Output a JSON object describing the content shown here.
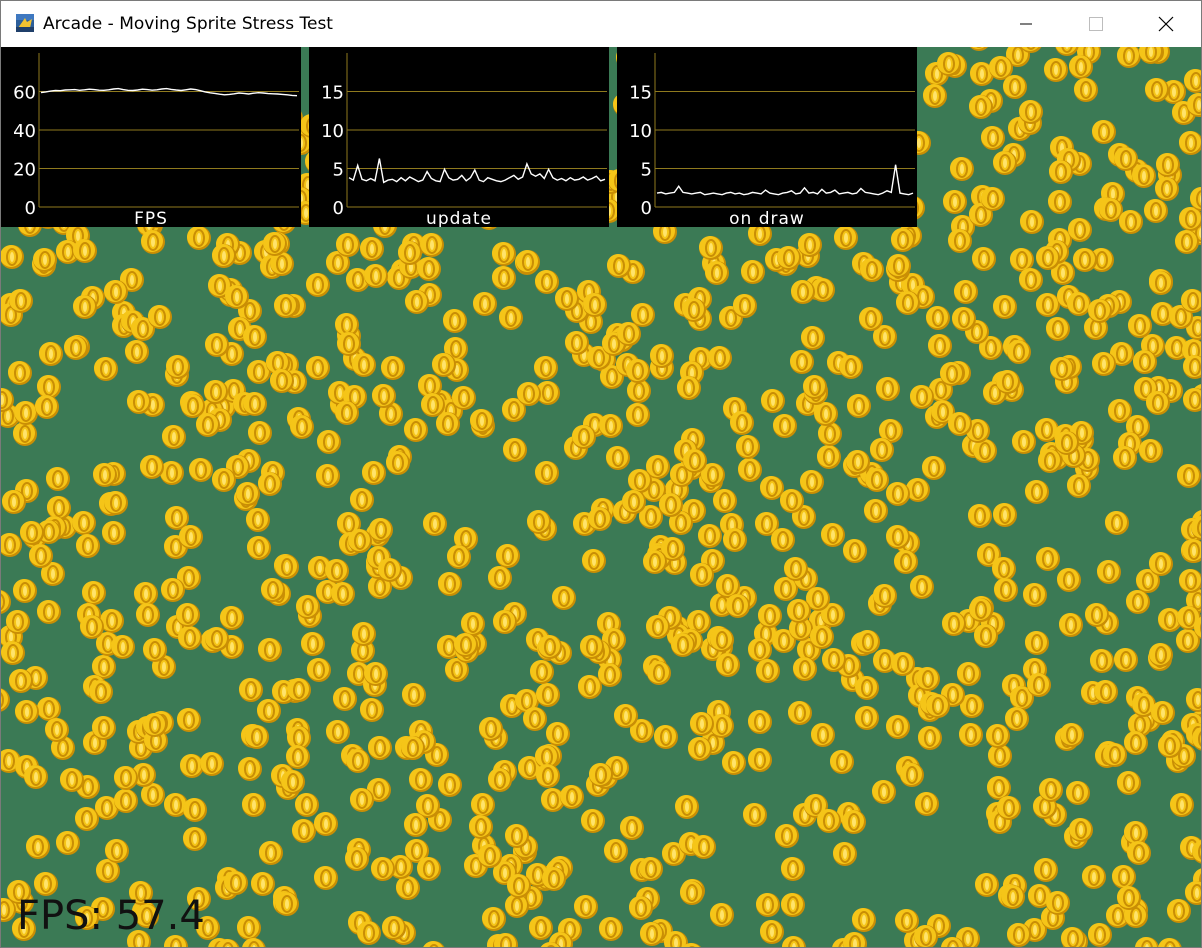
{
  "window": {
    "title": "Arcade - Moving Sprite Stress Test",
    "icon": "python-arcade-icon",
    "controls": [
      "minimize-icon",
      "maximize-icon",
      "close-icon"
    ]
  },
  "colors": {
    "background": "#3b7a55",
    "coin": "#f5c518",
    "coin_dark": "#c98e05",
    "graph_bg": "#000000",
    "graph_grid": "#8f7a1e",
    "graph_line": "#ffffff",
    "graph_text": "#ffffff"
  },
  "graphs": [
    {
      "label": "FPS",
      "y_ticks": [
        "0",
        "20",
        "40",
        "60"
      ],
      "y_max": 80,
      "values": [
        59.5,
        59.8,
        60.2,
        60.5,
        60.4,
        60.8,
        60.9,
        61.0,
        60.6,
        60.9,
        61.2,
        61.0,
        60.7,
        60.6,
        60.9,
        61.3,
        61.5,
        61.0,
        60.6,
        60.5,
        60.8,
        61.2,
        61.0,
        60.7,
        60.9,
        61.3,
        61.5,
        61.1,
        60.8,
        60.5,
        60.9,
        61.3,
        61.0,
        60.4,
        59.8,
        59.3,
        59.0,
        58.6,
        58.3,
        58.5,
        58.8,
        59.2,
        59.0,
        58.7,
        59.1,
        59.4,
        59.2,
        58.9,
        58.8,
        58.7,
        58.5,
        58.3,
        58.0,
        57.8
      ]
    },
    {
      "label": "update",
      "y_ticks": [
        "0",
        "5",
        "10",
        "15"
      ],
      "y_max": 20,
      "values": [
        3.8,
        3.5,
        5.4,
        3.6,
        3.4,
        3.7,
        3.4,
        6.3,
        3.2,
        3.5,
        3.6,
        3.3,
        3.8,
        3.4,
        3.9,
        3.6,
        3.3,
        3.5,
        4.6,
        3.7,
        3.4,
        3.3,
        4.9,
        3.8,
        3.5,
        3.6,
        4.1,
        3.4,
        3.8,
        4.8,
        3.5,
        3.3,
        3.8,
        3.6,
        3.4,
        3.3,
        3.5,
        3.8,
        4.1,
        3.6,
        3.9,
        5.6,
        4.3,
        4.0,
        4.3,
        3.7,
        4.9,
        3.8,
        3.5,
        3.7,
        3.4,
        3.8,
        3.5,
        3.6,
        3.9,
        3.5,
        3.7,
        4.0,
        3.4,
        3.6
      ]
    },
    {
      "label": "on_draw",
      "y_ticks": [
        "0",
        "5",
        "10",
        "15"
      ],
      "y_max": 20,
      "values": [
        1.8,
        1.9,
        1.7,
        1.8,
        1.9,
        2.7,
        1.9,
        1.8,
        1.7,
        1.8,
        1.9,
        1.6,
        1.7,
        1.8,
        1.7,
        1.6,
        1.8,
        1.9,
        1.7,
        1.8,
        1.6,
        1.7,
        1.9,
        1.8,
        1.7,
        2.2,
        1.8,
        1.7,
        1.6,
        1.8,
        1.9,
        2.1,
        1.7,
        1.8,
        2.5,
        1.8,
        1.9,
        1.7,
        2.3,
        1.8,
        1.9,
        2.2,
        1.7,
        1.8,
        1.9,
        1.7,
        1.8,
        2.4,
        1.9,
        1.8,
        1.7,
        1.6,
        1.8,
        2.1,
        1.9,
        5.5,
        1.8,
        1.7,
        1.6,
        1.8
      ]
    }
  ],
  "fps_overlay": "FPS:  57.4"
}
